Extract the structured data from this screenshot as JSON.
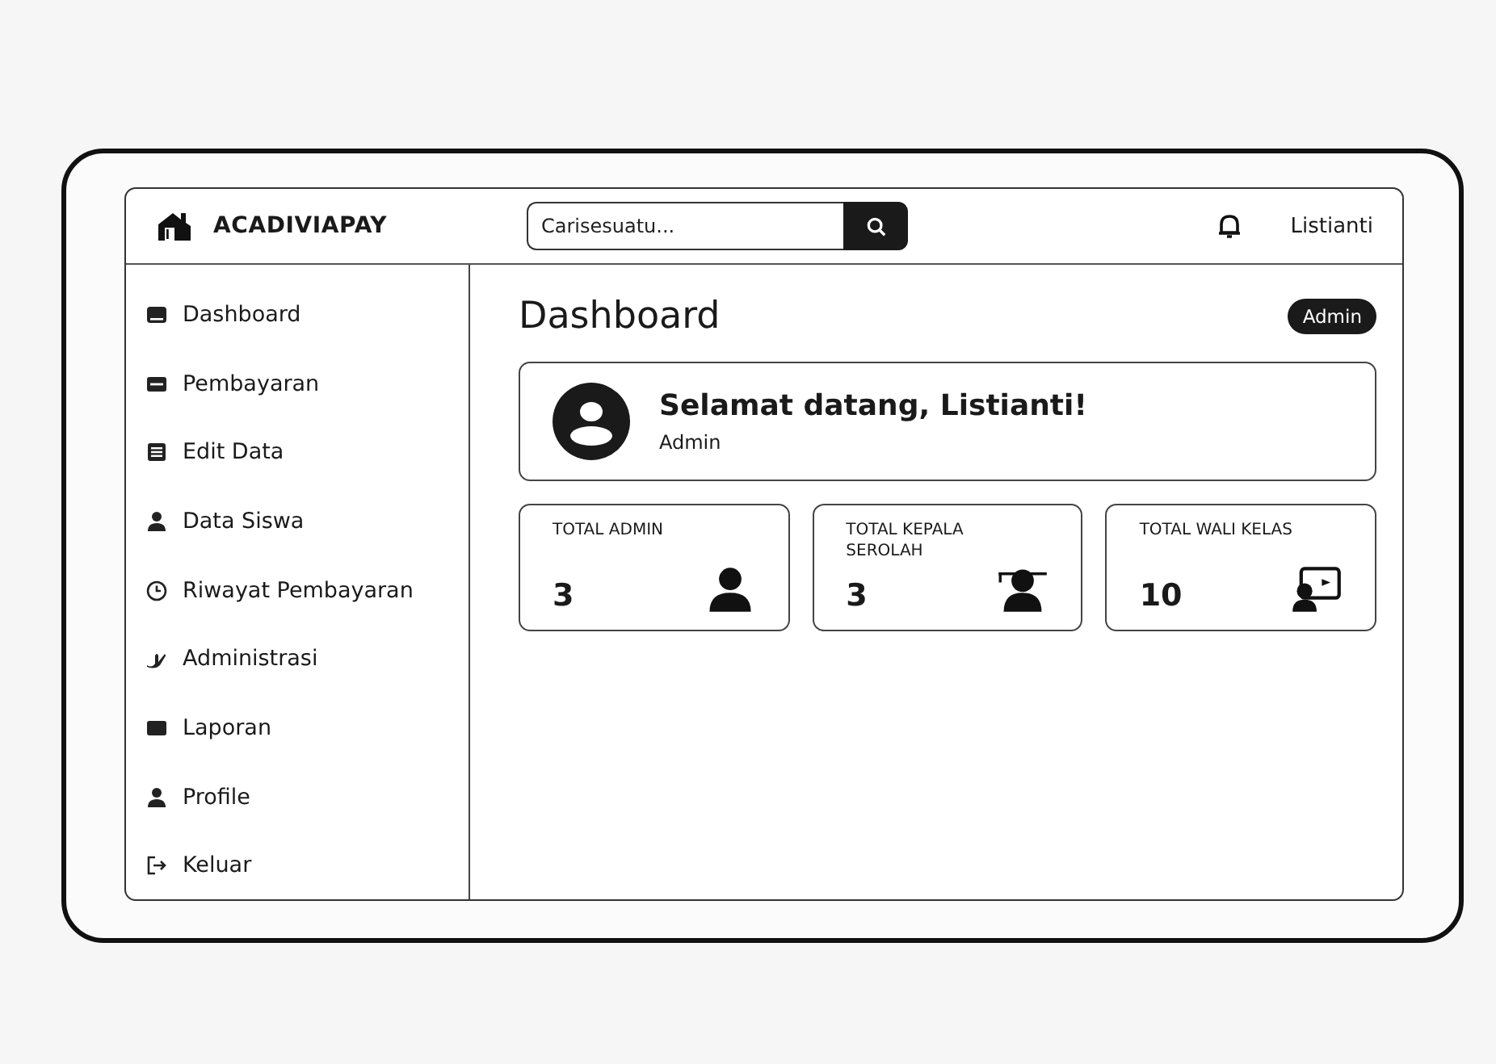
{
  "header": {
    "brand": "ACADIVIAPAY",
    "search": {
      "placeholder": "Carisesuatu..."
    },
    "user_name": "Listianti"
  },
  "sidebar": {
    "items": [
      {
        "label": "Dashboard"
      },
      {
        "label": "Pembayaran"
      },
      {
        "label": "Edit Data"
      },
      {
        "label": "Data Siswa"
      },
      {
        "label": "Riwayat Pembayaran"
      },
      {
        "label": "Administrasi"
      },
      {
        "label": "Laporan"
      },
      {
        "label": "Profile"
      },
      {
        "label": "Keluar"
      }
    ]
  },
  "main": {
    "title": "Dashboard",
    "role_badge": "Admin",
    "welcome": {
      "greeting": "Selamat datang, Listianti!",
      "role": "Admin"
    },
    "stats": [
      {
        "label": "TOTAL ADMIN",
        "value": "3"
      },
      {
        "label": "TOTAL KEPALA SEROLAH",
        "value": "3"
      },
      {
        "label": "TOTAL WALI KELAS",
        "value": "10"
      }
    ]
  }
}
